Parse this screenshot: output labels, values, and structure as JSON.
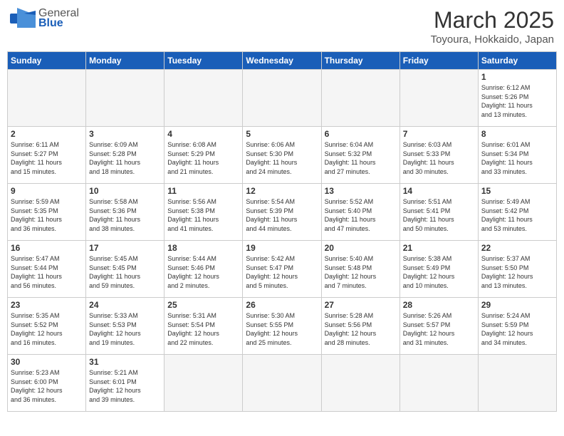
{
  "logo": {
    "text_general": "General",
    "text_blue": "Blue"
  },
  "header": {
    "month": "March 2025",
    "location": "Toyoura, Hokkaido, Japan"
  },
  "days_of_week": [
    "Sunday",
    "Monday",
    "Tuesday",
    "Wednesday",
    "Thursday",
    "Friday",
    "Saturday"
  ],
  "weeks": [
    [
      {
        "day": "",
        "info": ""
      },
      {
        "day": "",
        "info": ""
      },
      {
        "day": "",
        "info": ""
      },
      {
        "day": "",
        "info": ""
      },
      {
        "day": "",
        "info": ""
      },
      {
        "day": "",
        "info": ""
      },
      {
        "day": "1",
        "info": "Sunrise: 6:12 AM\nSunset: 5:26 PM\nDaylight: 11 hours\nand 13 minutes."
      }
    ],
    [
      {
        "day": "2",
        "info": "Sunrise: 6:11 AM\nSunset: 5:27 PM\nDaylight: 11 hours\nand 15 minutes."
      },
      {
        "day": "3",
        "info": "Sunrise: 6:09 AM\nSunset: 5:28 PM\nDaylight: 11 hours\nand 18 minutes."
      },
      {
        "day": "4",
        "info": "Sunrise: 6:08 AM\nSunset: 5:29 PM\nDaylight: 11 hours\nand 21 minutes."
      },
      {
        "day": "5",
        "info": "Sunrise: 6:06 AM\nSunset: 5:30 PM\nDaylight: 11 hours\nand 24 minutes."
      },
      {
        "day": "6",
        "info": "Sunrise: 6:04 AM\nSunset: 5:32 PM\nDaylight: 11 hours\nand 27 minutes."
      },
      {
        "day": "7",
        "info": "Sunrise: 6:03 AM\nSunset: 5:33 PM\nDaylight: 11 hours\nand 30 minutes."
      },
      {
        "day": "8",
        "info": "Sunrise: 6:01 AM\nSunset: 5:34 PM\nDaylight: 11 hours\nand 33 minutes."
      }
    ],
    [
      {
        "day": "9",
        "info": "Sunrise: 5:59 AM\nSunset: 5:35 PM\nDaylight: 11 hours\nand 36 minutes."
      },
      {
        "day": "10",
        "info": "Sunrise: 5:58 AM\nSunset: 5:36 PM\nDaylight: 11 hours\nand 38 minutes."
      },
      {
        "day": "11",
        "info": "Sunrise: 5:56 AM\nSunset: 5:38 PM\nDaylight: 11 hours\nand 41 minutes."
      },
      {
        "day": "12",
        "info": "Sunrise: 5:54 AM\nSunset: 5:39 PM\nDaylight: 11 hours\nand 44 minutes."
      },
      {
        "day": "13",
        "info": "Sunrise: 5:52 AM\nSunset: 5:40 PM\nDaylight: 11 hours\nand 47 minutes."
      },
      {
        "day": "14",
        "info": "Sunrise: 5:51 AM\nSunset: 5:41 PM\nDaylight: 11 hours\nand 50 minutes."
      },
      {
        "day": "15",
        "info": "Sunrise: 5:49 AM\nSunset: 5:42 PM\nDaylight: 11 hours\nand 53 minutes."
      }
    ],
    [
      {
        "day": "16",
        "info": "Sunrise: 5:47 AM\nSunset: 5:44 PM\nDaylight: 11 hours\nand 56 minutes."
      },
      {
        "day": "17",
        "info": "Sunrise: 5:45 AM\nSunset: 5:45 PM\nDaylight: 11 hours\nand 59 minutes."
      },
      {
        "day": "18",
        "info": "Sunrise: 5:44 AM\nSunset: 5:46 PM\nDaylight: 12 hours\nand 2 minutes."
      },
      {
        "day": "19",
        "info": "Sunrise: 5:42 AM\nSunset: 5:47 PM\nDaylight: 12 hours\nand 5 minutes."
      },
      {
        "day": "20",
        "info": "Sunrise: 5:40 AM\nSunset: 5:48 PM\nDaylight: 12 hours\nand 7 minutes."
      },
      {
        "day": "21",
        "info": "Sunrise: 5:38 AM\nSunset: 5:49 PM\nDaylight: 12 hours\nand 10 minutes."
      },
      {
        "day": "22",
        "info": "Sunrise: 5:37 AM\nSunset: 5:50 PM\nDaylight: 12 hours\nand 13 minutes."
      }
    ],
    [
      {
        "day": "23",
        "info": "Sunrise: 5:35 AM\nSunset: 5:52 PM\nDaylight: 12 hours\nand 16 minutes."
      },
      {
        "day": "24",
        "info": "Sunrise: 5:33 AM\nSunset: 5:53 PM\nDaylight: 12 hours\nand 19 minutes."
      },
      {
        "day": "25",
        "info": "Sunrise: 5:31 AM\nSunset: 5:54 PM\nDaylight: 12 hours\nand 22 minutes."
      },
      {
        "day": "26",
        "info": "Sunrise: 5:30 AM\nSunset: 5:55 PM\nDaylight: 12 hours\nand 25 minutes."
      },
      {
        "day": "27",
        "info": "Sunrise: 5:28 AM\nSunset: 5:56 PM\nDaylight: 12 hours\nand 28 minutes."
      },
      {
        "day": "28",
        "info": "Sunrise: 5:26 AM\nSunset: 5:57 PM\nDaylight: 12 hours\nand 31 minutes."
      },
      {
        "day": "29",
        "info": "Sunrise: 5:24 AM\nSunset: 5:59 PM\nDaylight: 12 hours\nand 34 minutes."
      }
    ],
    [
      {
        "day": "30",
        "info": "Sunrise: 5:23 AM\nSunset: 6:00 PM\nDaylight: 12 hours\nand 36 minutes."
      },
      {
        "day": "31",
        "info": "Sunrise: 5:21 AM\nSunset: 6:01 PM\nDaylight: 12 hours\nand 39 minutes."
      },
      {
        "day": "",
        "info": ""
      },
      {
        "day": "",
        "info": ""
      },
      {
        "day": "",
        "info": ""
      },
      {
        "day": "",
        "info": ""
      },
      {
        "day": "",
        "info": ""
      }
    ]
  ]
}
